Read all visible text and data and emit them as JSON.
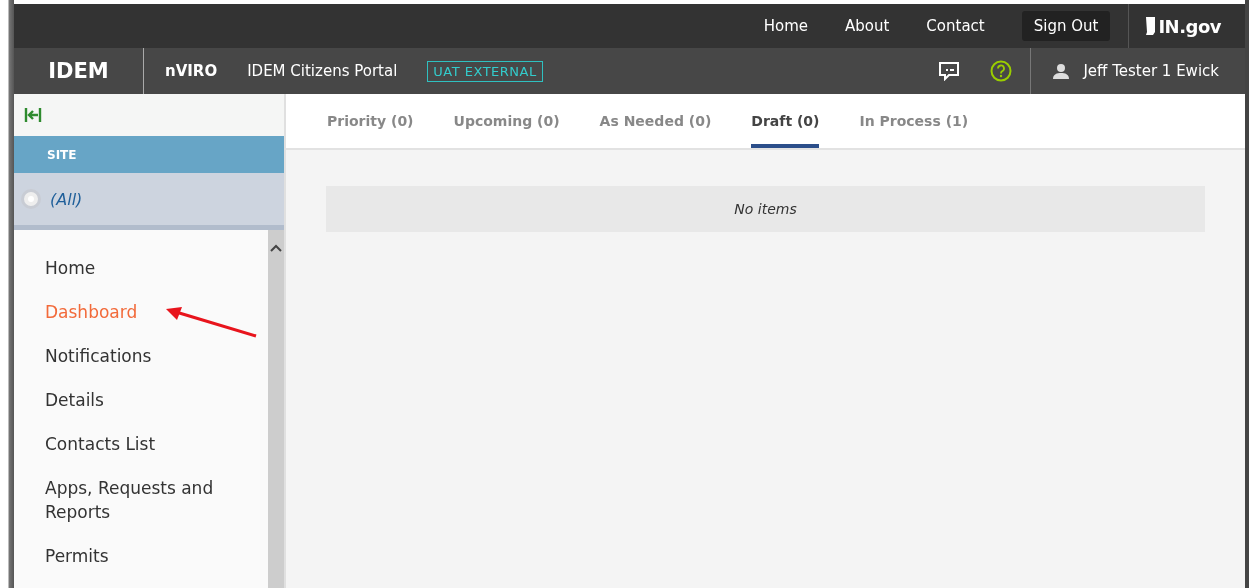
{
  "top_nav": {
    "links": [
      "Home",
      "About",
      "Contact"
    ],
    "sign_out": "Sign Out",
    "logo": "IN.gov"
  },
  "header": {
    "brand": "IDEM",
    "app": "nVIRO",
    "portal": "IDEM Citizens Portal",
    "env_badge": "UAT EXTERNAL",
    "user": "Jeff Tester 1 Ewick"
  },
  "sidebar": {
    "section": "SITE",
    "site_option": {
      "label": "(All)",
      "selected": true
    },
    "items": [
      {
        "label": "Home",
        "selected": false
      },
      {
        "label": "Dashboard",
        "selected": true
      },
      {
        "label": "Notifications",
        "selected": false
      },
      {
        "label": "Details",
        "selected": false
      },
      {
        "label": "Contacts List",
        "selected": false
      },
      {
        "label": "Apps, Requests and Reports",
        "selected": false
      },
      {
        "label": "Permits",
        "selected": false
      }
    ]
  },
  "tabs": [
    {
      "label": "Priority (0)",
      "selected": false
    },
    {
      "label": "Upcoming (0)",
      "selected": false
    },
    {
      "label": "As Needed (0)",
      "selected": false
    },
    {
      "label": "Draft (0)",
      "selected": true
    },
    {
      "label": "In Process (1)",
      "selected": false
    }
  ],
  "empty_message": "No items"
}
